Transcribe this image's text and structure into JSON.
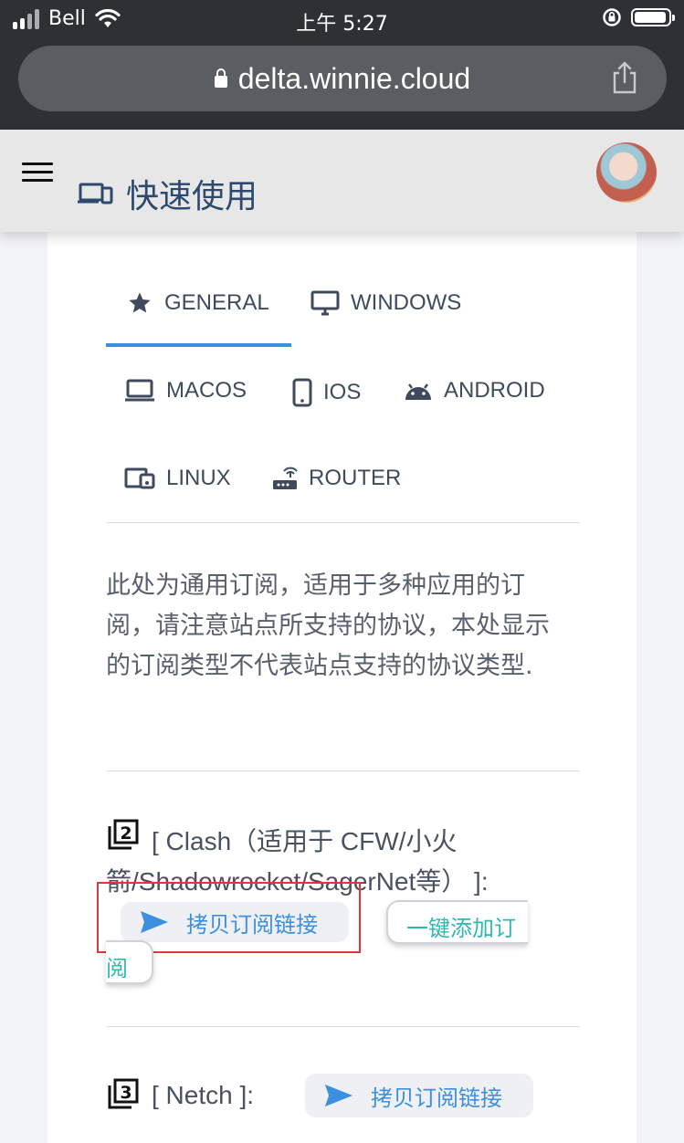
{
  "status_bar": {
    "carrier": "Bell",
    "time": "上午 5:27"
  },
  "browser": {
    "url": "delta.winnie.cloud"
  },
  "header": {
    "title": "快速使用"
  },
  "tabs": [
    {
      "label": "GENERAL",
      "icon": "star-icon"
    },
    {
      "label": "WINDOWS",
      "icon": "monitor-icon"
    },
    {
      "label": "MACOS",
      "icon": "laptop-icon"
    },
    {
      "label": "IOS",
      "icon": "phone-icon"
    },
    {
      "label": "ANDROID",
      "icon": "android-icon"
    },
    {
      "label": "LINUX",
      "icon": "devices-icon"
    },
    {
      "label": "ROUTER",
      "icon": "router-icon"
    }
  ],
  "description": "此处为通用订阅，适用于多种应用的订阅，请注意站点所支持的协议，本处显示的订阅类型不代表站点支持的协议类型.",
  "sections": [
    {
      "title_line1": "[ Clash（适用于 CFW/小火",
      "title_line2": "箭/Shadowrocket/SagerNet等） ]:",
      "copy_label": "拷贝订阅链接",
      "add_label_part1": "一键添加订",
      "add_label_part2": "阅"
    },
    {
      "title": "[ Netch ]:",
      "copy_label": "拷贝订阅链接"
    }
  ],
  "colors": {
    "accent": "#3d8fe0",
    "teal": "#2eb8b0",
    "title": "#2d4a6e"
  }
}
